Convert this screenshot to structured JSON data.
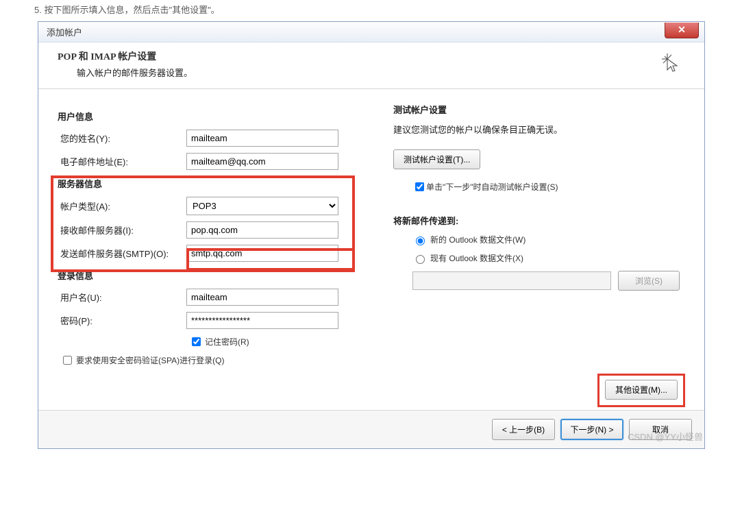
{
  "instruction": "5. 按下图所示填入信息，然后点击\"其他设置\"。",
  "dialog": {
    "title": "添加帐户",
    "header_title": "POP 和 IMAP 帐户设置",
    "header_sub": "输入帐户的邮件服务器设置。"
  },
  "sections": {
    "user_info": "用户信息",
    "server_info": "服务器信息",
    "login_info": "登录信息",
    "test_settings": "测试帐户设置",
    "deliver_to": "将新邮件传递到:"
  },
  "labels": {
    "name": "您的姓名(Y):",
    "email": "电子邮件地址(E):",
    "account_type": "帐户类型(A):",
    "incoming": "接收邮件服务器(I):",
    "outgoing": "发送邮件服务器(SMTP)(O):",
    "username": "用户名(U):",
    "password": "密码(P):",
    "remember_pw": "记住密码(R)",
    "require_spa": "要求使用安全密码验证(SPA)进行登录(Q)",
    "test_desc": "建议您测试您的帐户以确保条目正确无误。",
    "test_btn": "测试帐户设置(T)...",
    "auto_test": "单击\"下一步\"时自动测试帐户设置(S)",
    "new_file": "新的 Outlook 数据文件(W)",
    "existing_file": "现有 Outlook 数据文件(X)",
    "browse": "浏览(S)",
    "more_settings": "其他设置(M)..."
  },
  "values": {
    "name": "mailteam",
    "email": "mailteam@qq.com",
    "account_type": "POP3",
    "incoming": "pop.qq.com",
    "outgoing": "smtp.qq.com",
    "username": "mailteam",
    "password": "*****************"
  },
  "footer": {
    "back": "< 上一步(B)",
    "next": "下一步(N) >",
    "cancel": "取消"
  },
  "watermark": "CSDN @YY小怪兽"
}
